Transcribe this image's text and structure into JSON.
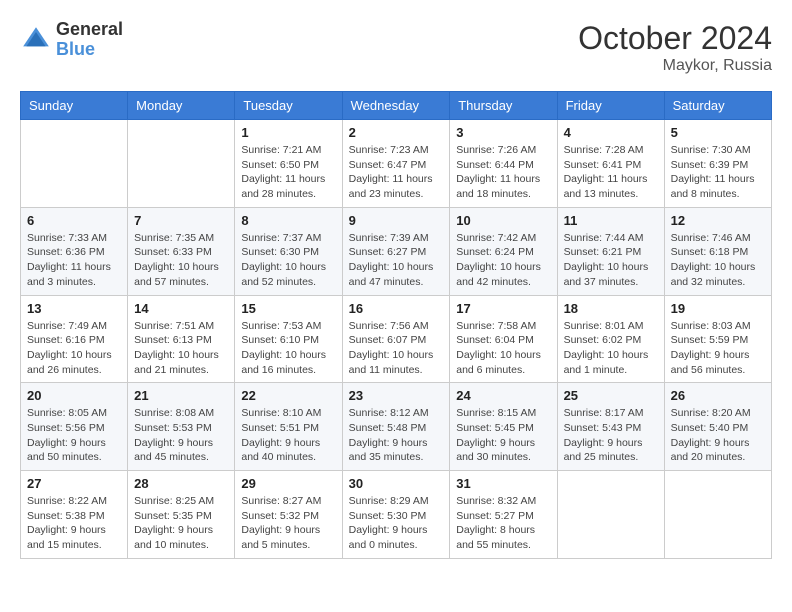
{
  "logo": {
    "text_general": "General",
    "text_blue": "Blue"
  },
  "title": {
    "month_year": "October 2024",
    "location": "Maykor, Russia"
  },
  "headers": [
    "Sunday",
    "Monday",
    "Tuesday",
    "Wednesday",
    "Thursday",
    "Friday",
    "Saturday"
  ],
  "weeks": [
    [
      {
        "day": "",
        "sunrise": "",
        "sunset": "",
        "daylight": ""
      },
      {
        "day": "",
        "sunrise": "",
        "sunset": "",
        "daylight": ""
      },
      {
        "day": "1",
        "sunrise": "Sunrise: 7:21 AM",
        "sunset": "Sunset: 6:50 PM",
        "daylight": "Daylight: 11 hours and 28 minutes."
      },
      {
        "day": "2",
        "sunrise": "Sunrise: 7:23 AM",
        "sunset": "Sunset: 6:47 PM",
        "daylight": "Daylight: 11 hours and 23 minutes."
      },
      {
        "day": "3",
        "sunrise": "Sunrise: 7:26 AM",
        "sunset": "Sunset: 6:44 PM",
        "daylight": "Daylight: 11 hours and 18 minutes."
      },
      {
        "day": "4",
        "sunrise": "Sunrise: 7:28 AM",
        "sunset": "Sunset: 6:41 PM",
        "daylight": "Daylight: 11 hours and 13 minutes."
      },
      {
        "day": "5",
        "sunrise": "Sunrise: 7:30 AM",
        "sunset": "Sunset: 6:39 PM",
        "daylight": "Daylight: 11 hours and 8 minutes."
      }
    ],
    [
      {
        "day": "6",
        "sunrise": "Sunrise: 7:33 AM",
        "sunset": "Sunset: 6:36 PM",
        "daylight": "Daylight: 11 hours and 3 minutes."
      },
      {
        "day": "7",
        "sunrise": "Sunrise: 7:35 AM",
        "sunset": "Sunset: 6:33 PM",
        "daylight": "Daylight: 10 hours and 57 minutes."
      },
      {
        "day": "8",
        "sunrise": "Sunrise: 7:37 AM",
        "sunset": "Sunset: 6:30 PM",
        "daylight": "Daylight: 10 hours and 52 minutes."
      },
      {
        "day": "9",
        "sunrise": "Sunrise: 7:39 AM",
        "sunset": "Sunset: 6:27 PM",
        "daylight": "Daylight: 10 hours and 47 minutes."
      },
      {
        "day": "10",
        "sunrise": "Sunrise: 7:42 AM",
        "sunset": "Sunset: 6:24 PM",
        "daylight": "Daylight: 10 hours and 42 minutes."
      },
      {
        "day": "11",
        "sunrise": "Sunrise: 7:44 AM",
        "sunset": "Sunset: 6:21 PM",
        "daylight": "Daylight: 10 hours and 37 minutes."
      },
      {
        "day": "12",
        "sunrise": "Sunrise: 7:46 AM",
        "sunset": "Sunset: 6:18 PM",
        "daylight": "Daylight: 10 hours and 32 minutes."
      }
    ],
    [
      {
        "day": "13",
        "sunrise": "Sunrise: 7:49 AM",
        "sunset": "Sunset: 6:16 PM",
        "daylight": "Daylight: 10 hours and 26 minutes."
      },
      {
        "day": "14",
        "sunrise": "Sunrise: 7:51 AM",
        "sunset": "Sunset: 6:13 PM",
        "daylight": "Daylight: 10 hours and 21 minutes."
      },
      {
        "day": "15",
        "sunrise": "Sunrise: 7:53 AM",
        "sunset": "Sunset: 6:10 PM",
        "daylight": "Daylight: 10 hours and 16 minutes."
      },
      {
        "day": "16",
        "sunrise": "Sunrise: 7:56 AM",
        "sunset": "Sunset: 6:07 PM",
        "daylight": "Daylight: 10 hours and 11 minutes."
      },
      {
        "day": "17",
        "sunrise": "Sunrise: 7:58 AM",
        "sunset": "Sunset: 6:04 PM",
        "daylight": "Daylight: 10 hours and 6 minutes."
      },
      {
        "day": "18",
        "sunrise": "Sunrise: 8:01 AM",
        "sunset": "Sunset: 6:02 PM",
        "daylight": "Daylight: 10 hours and 1 minute."
      },
      {
        "day": "19",
        "sunrise": "Sunrise: 8:03 AM",
        "sunset": "Sunset: 5:59 PM",
        "daylight": "Daylight: 9 hours and 56 minutes."
      }
    ],
    [
      {
        "day": "20",
        "sunrise": "Sunrise: 8:05 AM",
        "sunset": "Sunset: 5:56 PM",
        "daylight": "Daylight: 9 hours and 50 minutes."
      },
      {
        "day": "21",
        "sunrise": "Sunrise: 8:08 AM",
        "sunset": "Sunset: 5:53 PM",
        "daylight": "Daylight: 9 hours and 45 minutes."
      },
      {
        "day": "22",
        "sunrise": "Sunrise: 8:10 AM",
        "sunset": "Sunset: 5:51 PM",
        "daylight": "Daylight: 9 hours and 40 minutes."
      },
      {
        "day": "23",
        "sunrise": "Sunrise: 8:12 AM",
        "sunset": "Sunset: 5:48 PM",
        "daylight": "Daylight: 9 hours and 35 minutes."
      },
      {
        "day": "24",
        "sunrise": "Sunrise: 8:15 AM",
        "sunset": "Sunset: 5:45 PM",
        "daylight": "Daylight: 9 hours and 30 minutes."
      },
      {
        "day": "25",
        "sunrise": "Sunrise: 8:17 AM",
        "sunset": "Sunset: 5:43 PM",
        "daylight": "Daylight: 9 hours and 25 minutes."
      },
      {
        "day": "26",
        "sunrise": "Sunrise: 8:20 AM",
        "sunset": "Sunset: 5:40 PM",
        "daylight": "Daylight: 9 hours and 20 minutes."
      }
    ],
    [
      {
        "day": "27",
        "sunrise": "Sunrise: 8:22 AM",
        "sunset": "Sunset: 5:38 PM",
        "daylight": "Daylight: 9 hours and 15 minutes."
      },
      {
        "day": "28",
        "sunrise": "Sunrise: 8:25 AM",
        "sunset": "Sunset: 5:35 PM",
        "daylight": "Daylight: 9 hours and 10 minutes."
      },
      {
        "day": "29",
        "sunrise": "Sunrise: 8:27 AM",
        "sunset": "Sunset: 5:32 PM",
        "daylight": "Daylight: 9 hours and 5 minutes."
      },
      {
        "day": "30",
        "sunrise": "Sunrise: 8:29 AM",
        "sunset": "Sunset: 5:30 PM",
        "daylight": "Daylight: 9 hours and 0 minutes."
      },
      {
        "day": "31",
        "sunrise": "Sunrise: 8:32 AM",
        "sunset": "Sunset: 5:27 PM",
        "daylight": "Daylight: 8 hours and 55 minutes."
      },
      {
        "day": "",
        "sunrise": "",
        "sunset": "",
        "daylight": ""
      },
      {
        "day": "",
        "sunrise": "",
        "sunset": "",
        "daylight": ""
      }
    ]
  ]
}
